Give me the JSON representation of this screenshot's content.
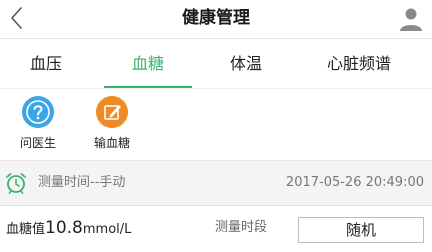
{
  "header": {
    "title": "健康管理",
    "back_icon": "chevron-left-icon",
    "user_icon": "user-icon"
  },
  "tabs": [
    {
      "label": "血压",
      "active": false
    },
    {
      "label": "血糖",
      "active": true
    },
    {
      "label": "体温",
      "active": false
    },
    {
      "label": "心脏频谱",
      "active": false
    }
  ],
  "actions": [
    {
      "label": "问医生",
      "icon": "question-icon",
      "color": "#3aa6e8"
    },
    {
      "label": "输血糖",
      "icon": "edit-icon",
      "color": "#f08a24"
    }
  ],
  "measure_time": {
    "label": "测量时间--手动",
    "value": "2017-05-26 20:49:00",
    "icon": "alarm-clock-icon"
  },
  "glucose": {
    "prefix": "血糖值",
    "value": "10.8",
    "unit": "mmol/L",
    "period_label": "测量时段",
    "period_value": "随机"
  },
  "colors": {
    "accent": "#3ab36b",
    "ask_doctor": "#3aa6e8",
    "input_glucose": "#f08a24"
  }
}
